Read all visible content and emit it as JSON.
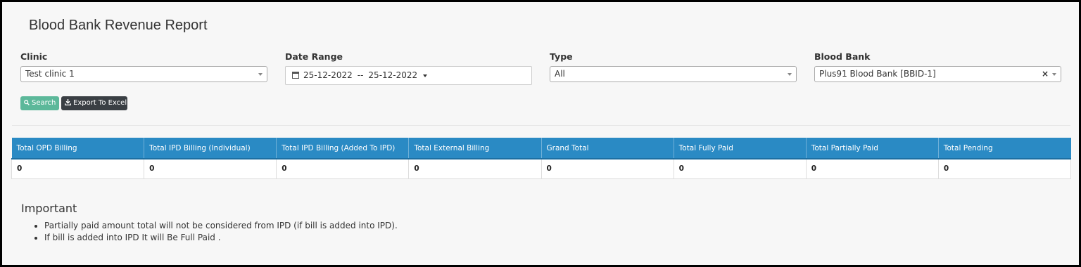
{
  "page": {
    "title": "Blood Bank Revenue Report"
  },
  "filters": {
    "clinic": {
      "label": "Clinic",
      "value": "Test clinic 1"
    },
    "date_range": {
      "label": "Date Range",
      "from": "25-12-2022",
      "separator": "--",
      "to": "25-12-2022"
    },
    "type": {
      "label": "Type",
      "value": "All"
    },
    "blood_bank": {
      "label": "Blood Bank",
      "value": "Plus91 Blood Bank [BBID-1]",
      "clear": "×"
    }
  },
  "actions": {
    "search_label": "Search",
    "search_icon": "search-icon",
    "export_label": "Export To Excel",
    "export_icon": "download-icon"
  },
  "table": {
    "columns": [
      "Total OPD Billing",
      "Total IPD Billing (Individual)",
      "Total IPD Billing (Added To IPD)",
      "Total External Billing",
      "Grand Total",
      "Total Fully Paid",
      "Total Partially Paid",
      "Total Pending"
    ],
    "rows": [
      [
        "0",
        "0",
        "0",
        "0",
        "0",
        "0",
        "0",
        "0"
      ]
    ]
  },
  "important": {
    "title": "Important",
    "notes": [
      "Partially paid amount total will not be considered from IPD (if bill is added into IPD).",
      "If bill is added into IPD It will Be Full Paid ."
    ]
  },
  "colors": {
    "table_header": "#2a8ac4",
    "search_button": "#5cb89a",
    "export_button": "#3a3f44"
  }
}
